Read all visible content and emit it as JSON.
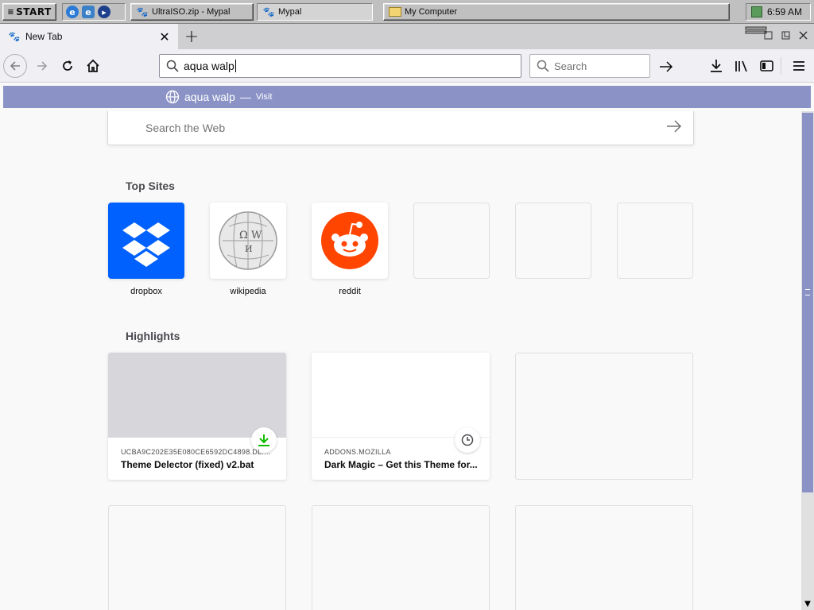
{
  "taskbar": {
    "start_label": "START",
    "tasks": [
      {
        "label": "UltraISO.zip - Mypal"
      },
      {
        "label": "Mypal"
      },
      {
        "label": "My Computer"
      }
    ],
    "clock": "6:59 AM"
  },
  "tabs": [
    {
      "label": "New Tab"
    }
  ],
  "navbar": {
    "url_value": "aqua walp",
    "search_placeholder": "Search"
  },
  "suggestion": {
    "text": "aqua walp",
    "separator": "—",
    "action": "Visit"
  },
  "page": {
    "web_search_placeholder": "Search the Web",
    "top_sites_title": "Top Sites",
    "top_sites": [
      {
        "label": "dropbox",
        "icon": "dropbox-icon",
        "color": "#0061fe"
      },
      {
        "label": "wikipedia",
        "icon": "wikipedia-globe-icon",
        "color": "#ffffff"
      },
      {
        "label": "reddit",
        "icon": "reddit-icon",
        "color": "#ff4500"
      },
      {
        "label": ""
      },
      {
        "label": ""
      },
      {
        "label": ""
      }
    ],
    "highlights_title": "Highlights",
    "highlights": [
      {
        "source": "UCBA9C202E35E080CE6592DC4898.DL.DR...",
        "title": "Theme Delector (fixed) v2.bat",
        "badge": "download-icon"
      },
      {
        "source": "ADDONS.MOZILLA",
        "title": "Dark Magic – Get this Theme for...",
        "badge": "clock-icon"
      }
    ]
  },
  "colors": {
    "accent": "#8b93c6",
    "dropbox": "#0061fe",
    "reddit": "#ff4500",
    "download_green": "#12bc00"
  }
}
